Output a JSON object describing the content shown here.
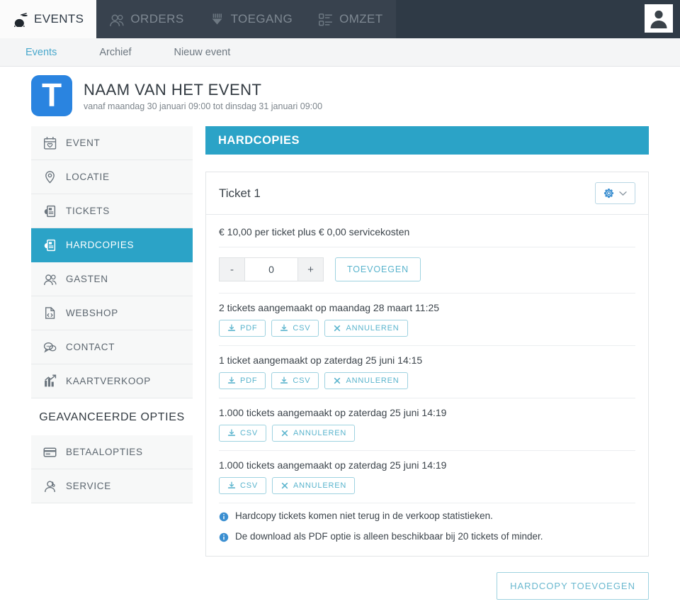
{
  "topnav": {
    "tabs": [
      {
        "label": "Events",
        "icon": "drums-icon",
        "active": true
      },
      {
        "label": "Orders",
        "icon": "users-icon",
        "active": false
      },
      {
        "label": "Toegang",
        "icon": "wristband-icon",
        "active": false
      },
      {
        "label": "Omzet",
        "icon": "list-icon",
        "active": false
      }
    ],
    "avatar_label": "user-avatar"
  },
  "subnav": {
    "items": [
      {
        "label": "Events",
        "active": true
      },
      {
        "label": "Archief",
        "active": false
      },
      {
        "label": "Nieuw event",
        "active": false
      }
    ]
  },
  "event": {
    "logo_letter": "T",
    "title": "Naam van het event",
    "subtitle": "vanaf maandag 30 januari 09:00 tot dinsdag 31 januari 09:00"
  },
  "sidebar": {
    "items": [
      {
        "label": "Event",
        "icon": "calendar-heart-icon",
        "active": false
      },
      {
        "label": "Locatie",
        "icon": "map-pin-icon",
        "active": false
      },
      {
        "label": "Tickets",
        "icon": "ticket-icon",
        "active": false
      },
      {
        "label": "Hardcopies",
        "icon": "ticket-icon",
        "active": true
      },
      {
        "label": "Gasten",
        "icon": "users-icon",
        "active": false
      },
      {
        "label": "Webshop",
        "icon": "code-file-icon",
        "active": false
      },
      {
        "label": "Contact",
        "icon": "chat-bubbles-icon",
        "active": false
      },
      {
        "label": "Kaartverkoop",
        "icon": "chart-icon",
        "active": false
      }
    ],
    "advanced_heading": "Geavanceerde opties",
    "advanced_items": [
      {
        "label": "Betaalopties",
        "icon": "credit-card-icon"
      },
      {
        "label": "Service",
        "icon": "support-agent-icon"
      }
    ]
  },
  "panel": {
    "header": "Hardcopies",
    "card": {
      "title": "Ticket 1",
      "gear_icon": "gear-icon",
      "chevron_icon": "chevron-down-icon",
      "price_line": "€ 10,00 per ticket plus € 0,00 servicekosten",
      "stepper": {
        "minus_label": "-",
        "plus_label": "+",
        "value": "0"
      },
      "add_button": "Toevoegen",
      "batches": [
        {
          "text": "2 tickets aangemaakt op maandag 28 maart 11:25",
          "buttons": [
            {
              "label": "PDF",
              "icon": "download-icon"
            },
            {
              "label": "CSV",
              "icon": "download-icon"
            },
            {
              "label": "Annuleren",
              "icon": "close-icon"
            }
          ]
        },
        {
          "text": "1 ticket aangemaakt op zaterdag 25 juni 14:15",
          "buttons": [
            {
              "label": "PDF",
              "icon": "download-icon"
            },
            {
              "label": "CSV",
              "icon": "download-icon"
            },
            {
              "label": "Annuleren",
              "icon": "close-icon"
            }
          ]
        },
        {
          "text": "1.000 tickets aangemaakt op zaterdag 25 juni 14:19",
          "buttons": [
            {
              "label": "CSV",
              "icon": "download-icon"
            },
            {
              "label": "Annuleren",
              "icon": "close-icon"
            }
          ]
        },
        {
          "text": "1.000 tickets aangemaakt op zaterdag 25 juni 14:19",
          "buttons": [
            {
              "label": "CSV",
              "icon": "download-icon"
            },
            {
              "label": "Annuleren",
              "icon": "close-icon"
            }
          ]
        }
      ],
      "notes": [
        {
          "icon": "info-icon",
          "text": "Hardcopy tickets komen niet terug in de verkoop statistieken."
        },
        {
          "icon": "info-icon",
          "text": "De download als PDF optie is alleen beschikbaar bij 20 tickets of minder."
        }
      ]
    },
    "footer_button": "Hardcopy toevoegen"
  },
  "colors": {
    "topnav_bg": "#2f3a46",
    "accent_teal": "#2ba3c7",
    "logo_blue": "#2a84e0",
    "outline_blue": "#9ed2e0",
    "text_dark": "#3c444b"
  }
}
